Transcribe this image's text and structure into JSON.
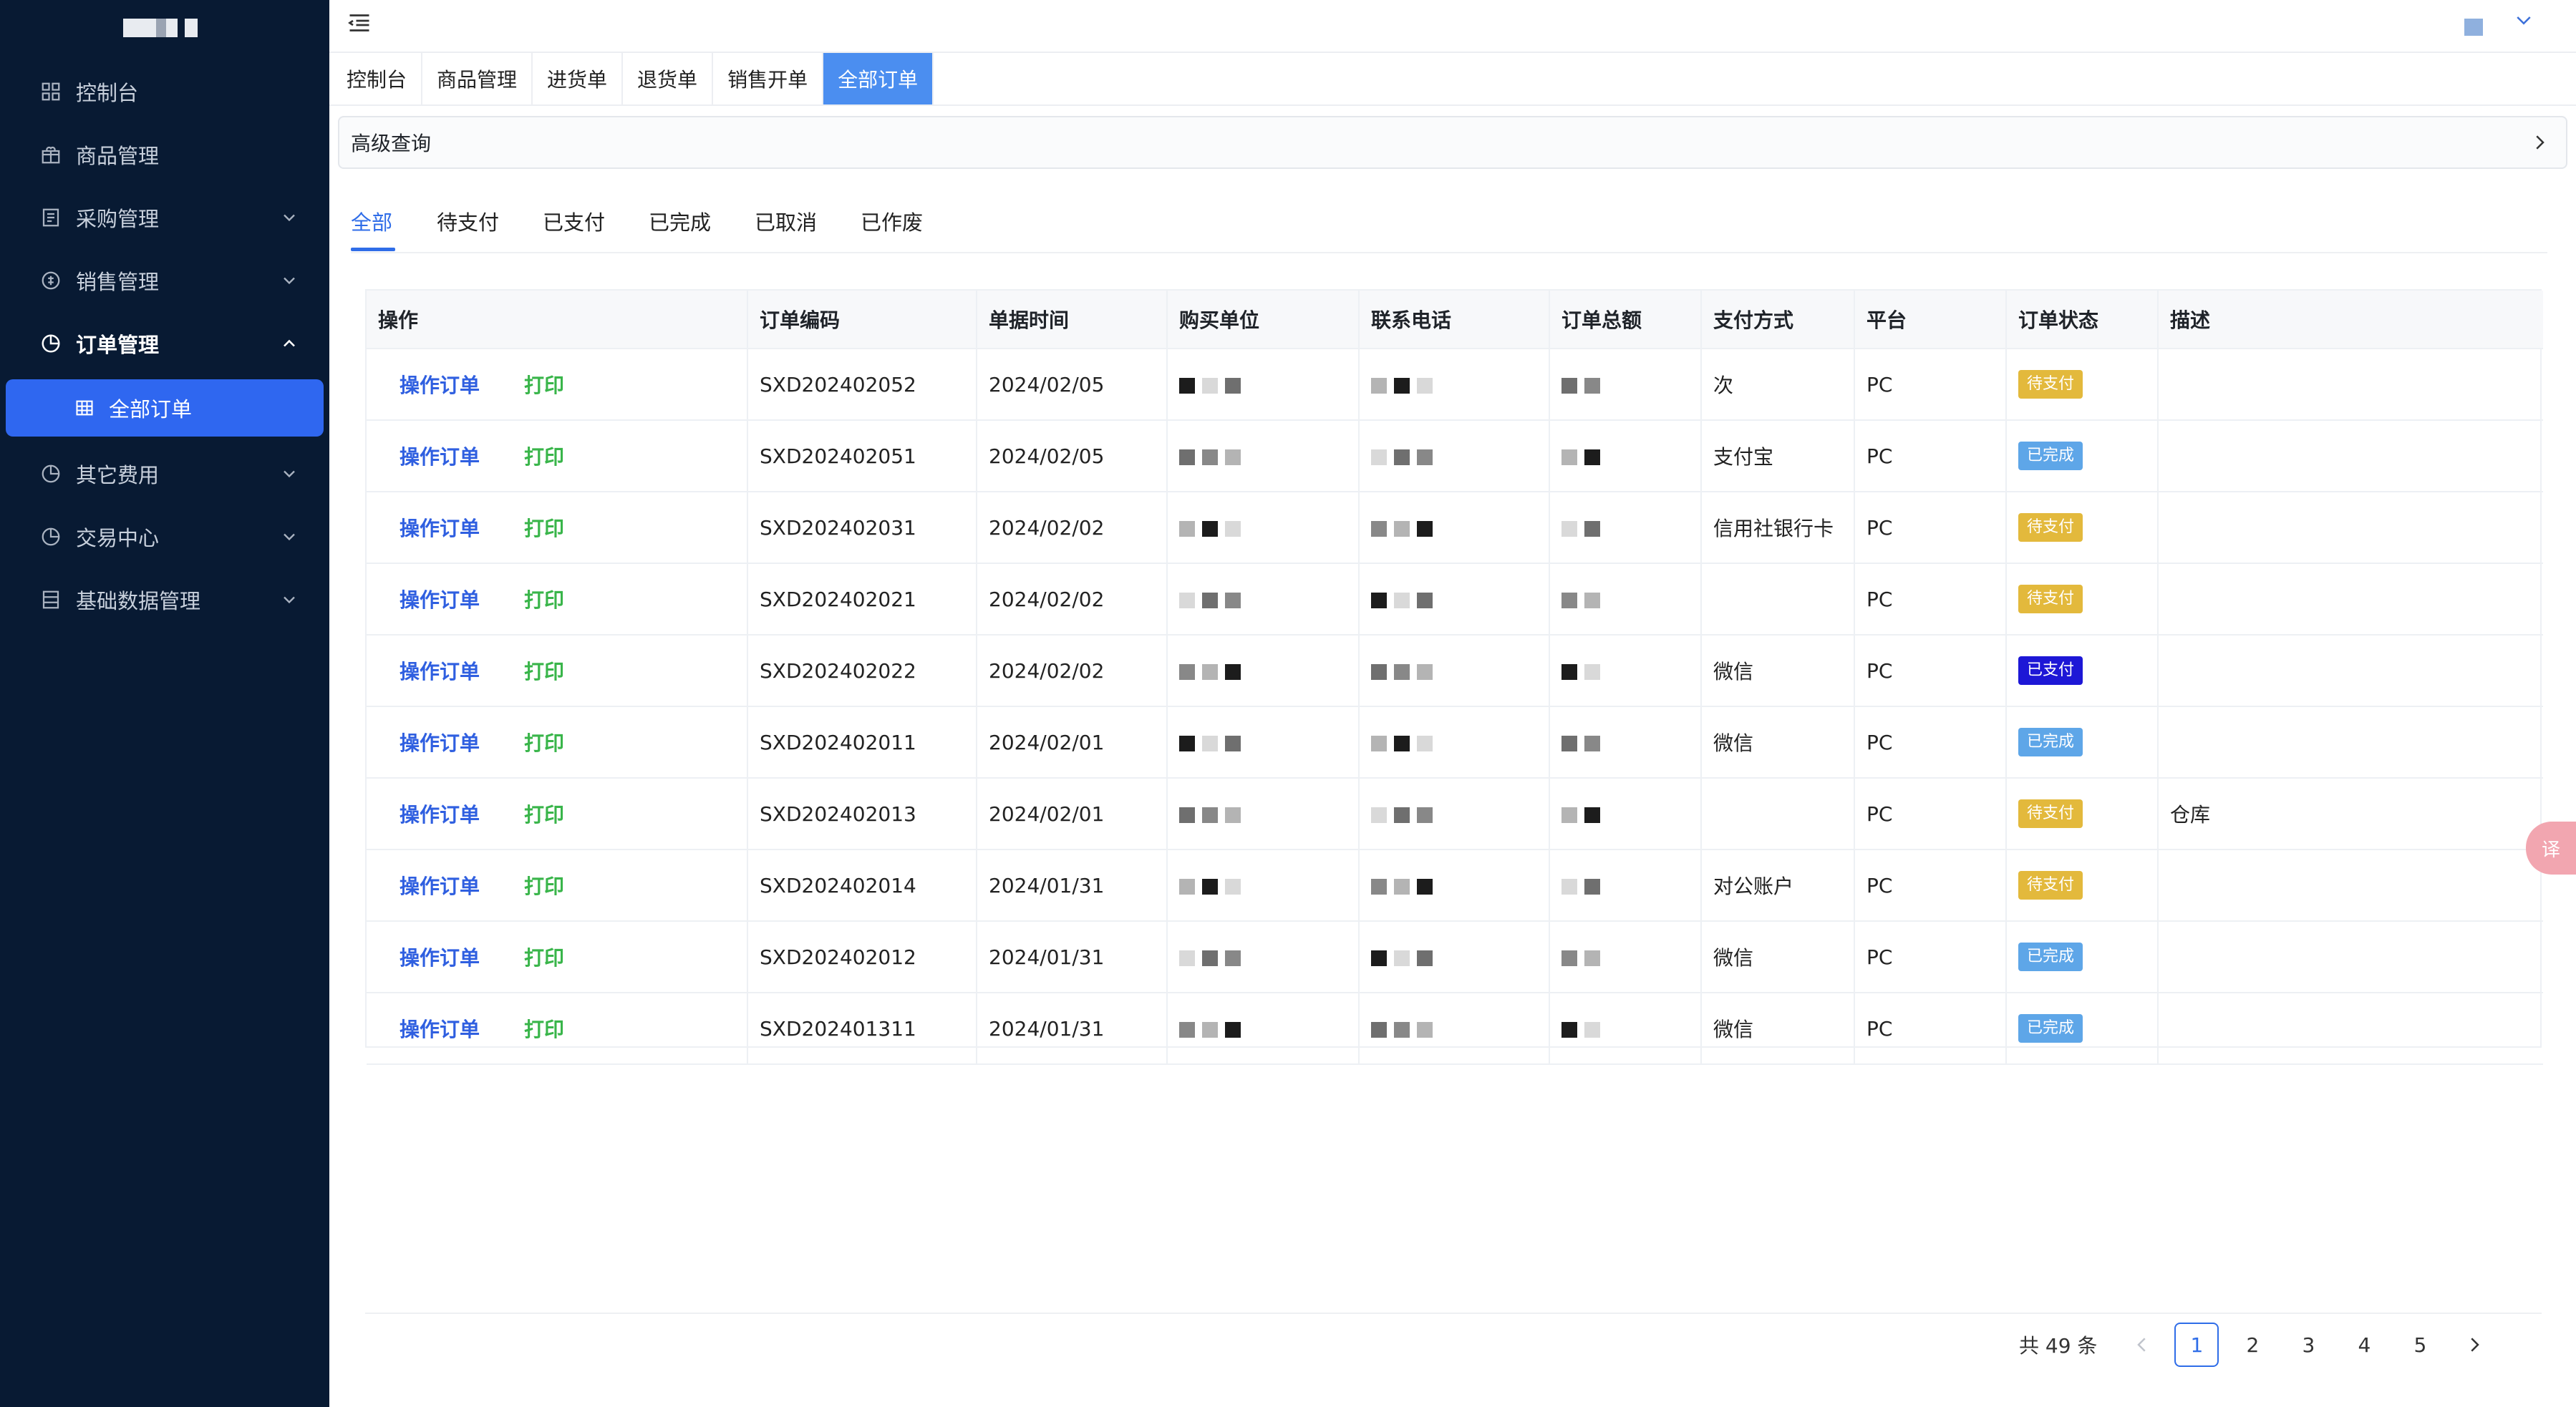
{
  "sidebar": {
    "items": [
      {
        "label": "控制台",
        "icon": "dashboard-icon"
      },
      {
        "label": "商品管理",
        "icon": "gift-icon"
      },
      {
        "label": "采购管理",
        "icon": "document-icon"
      },
      {
        "label": "销售管理",
        "icon": "sales-icon"
      },
      {
        "label": "订单管理",
        "icon": "order-icon"
      },
      {
        "label": "全部订单",
        "icon": "grid-icon"
      },
      {
        "label": "其它费用",
        "icon": "pie-icon"
      },
      {
        "label": "交易中心",
        "icon": "pie-icon"
      },
      {
        "label": "基础数据管理",
        "icon": "list-icon"
      }
    ]
  },
  "tabs": [
    "控制台",
    "商品管理",
    "进货单",
    "退货单",
    "销售开单",
    "全部订单"
  ],
  "advanced_query": "高级查询",
  "status_tabs": [
    "全部",
    "待支付",
    "已支付",
    "已完成",
    "已取消",
    "已作废"
  ],
  "table": {
    "headers": [
      "操作",
      "订单编码",
      "单据时间",
      "购买单位",
      "联系电话",
      "订单总额",
      "支付方式",
      "平台",
      "订单状态",
      "描述"
    ],
    "op_label": "操作订单",
    "print_label": "打印",
    "rows": [
      {
        "code": "SXD202402052",
        "date": "2024/02/05",
        "pay": "次",
        "platform": "PC",
        "status": "待支付",
        "desc": ""
      },
      {
        "code": "SXD202402051",
        "date": "2024/02/05",
        "pay": "支付宝",
        "platform": "PC",
        "status": "已完成",
        "desc": ""
      },
      {
        "code": "SXD202402031",
        "date": "2024/02/02",
        "pay": "信用社银行卡",
        "platform": "PC",
        "status": "待支付",
        "desc": ""
      },
      {
        "code": "SXD202402021",
        "date": "2024/02/02",
        "pay": "",
        "platform": "PC",
        "status": "待支付",
        "desc": ""
      },
      {
        "code": "SXD202402022",
        "date": "2024/02/02",
        "pay": "微信",
        "platform": "PC",
        "status": "已支付",
        "desc": ""
      },
      {
        "code": "SXD202402011",
        "date": "2024/02/01",
        "pay": "微信",
        "platform": "PC",
        "status": "已完成",
        "desc": ""
      },
      {
        "code": "SXD202402013",
        "date": "2024/02/01",
        "pay": "",
        "platform": "PC",
        "status": "待支付",
        "desc": "仓库"
      },
      {
        "code": "SXD202402014",
        "date": "2024/01/31",
        "pay": "对公账户",
        "platform": "PC",
        "status": "待支付",
        "desc": ""
      },
      {
        "code": "SXD202402012",
        "date": "2024/01/31",
        "pay": "微信",
        "platform": "PC",
        "status": "已完成",
        "desc": ""
      },
      {
        "code": "SXD202401311",
        "date": "2024/01/31",
        "pay": "微信",
        "platform": "PC",
        "status": "已完成",
        "desc": ""
      }
    ]
  },
  "status_colors": {
    "待支付": "#e3b93c",
    "已完成": "#5ea6e8",
    "已支付": "#1d17d6"
  },
  "pagination": {
    "total": "共 49 条",
    "pages": [
      "1",
      "2",
      "3",
      "4",
      "5"
    ],
    "current": "1"
  },
  "float_button": "译"
}
